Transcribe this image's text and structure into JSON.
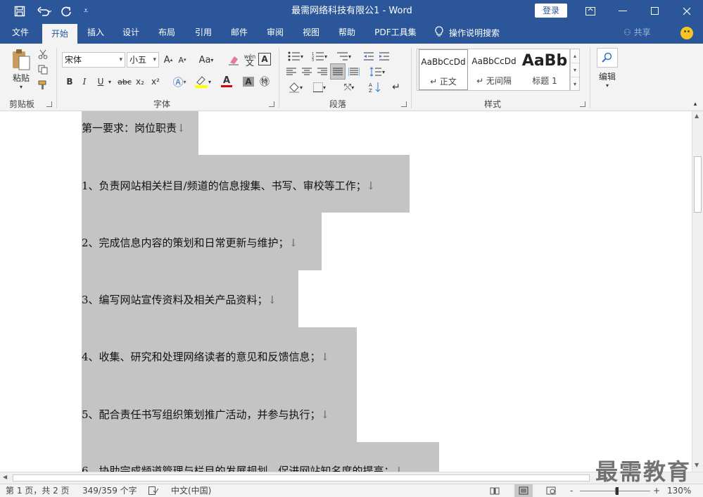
{
  "title_bar": {
    "document_title": "最需网络科技有限公1 - Word",
    "login_label": "登录",
    "save_icon": "save-icon",
    "undo_icon": "undo-icon",
    "redo_icon": "redo-icon"
  },
  "tabs": [
    {
      "label": "文件"
    },
    {
      "label": "开始",
      "active": true
    },
    {
      "label": "插入"
    },
    {
      "label": "设计"
    },
    {
      "label": "布局"
    },
    {
      "label": "引用"
    },
    {
      "label": "邮件"
    },
    {
      "label": "审阅"
    },
    {
      "label": "视图"
    },
    {
      "label": "帮助"
    },
    {
      "label": "PDF工具集"
    }
  ],
  "tell_me": "操作说明搜索",
  "share_label": "共享",
  "ribbon": {
    "clipboard": {
      "paste_label": "粘贴",
      "group_label": "剪贴板"
    },
    "font": {
      "font_name": "宋体",
      "font_size": "小五",
      "group_label": "字体",
      "pinyin_label": "wén",
      "bold": "B",
      "italic": "I",
      "underline": "U",
      "strike": "abc",
      "sub": "x₂",
      "sup": "x²"
    },
    "paragraph": {
      "group_label": "段落"
    },
    "styles": {
      "group_label": "样式",
      "items": [
        {
          "preview": "AaBbCcDd",
          "name": "↵ 正文"
        },
        {
          "preview": "AaBbCcDd",
          "name": "↵ 无间隔"
        },
        {
          "preview": "AaBb",
          "name": "标题 1"
        }
      ]
    },
    "editing": {
      "label": "编辑"
    }
  },
  "document": {
    "lines": [
      {
        "text": "第一要求：岗位职责",
        "mark": "↓"
      },
      {
        "text": "1、负责网站相关栏目/频道的信息搜集、书写、审校等工作；",
        "mark": "↓"
      },
      {
        "text": "2、完成信息内容的策划和日常更新与维护；",
        "mark": "↓"
      },
      {
        "text": "3、编写网站宣传资料及相关产品资料；",
        "mark": "↓"
      },
      {
        "text": "4、收集、研究和处理网络读者的意见和反馈信息；",
        "mark": "↓"
      },
      {
        "text": "5、配合责任书写组织策划推广活动，并参与执行；",
        "mark": "↓"
      },
      {
        "text": "6、协助完成频道管理与栏目的发展规划，促进网站知名度的提高；",
        "mark": "↓"
      }
    ]
  },
  "status_bar": {
    "page": "第 1 页，共 2 页",
    "words": "349/359 个字",
    "language": "中文(中国)",
    "zoom": "130%",
    "zoom_minus": "-",
    "zoom_plus": "+"
  },
  "watermark": "最需教育",
  "colors": {
    "brand": "#2b579a",
    "highlight": "#c4c4c4"
  }
}
